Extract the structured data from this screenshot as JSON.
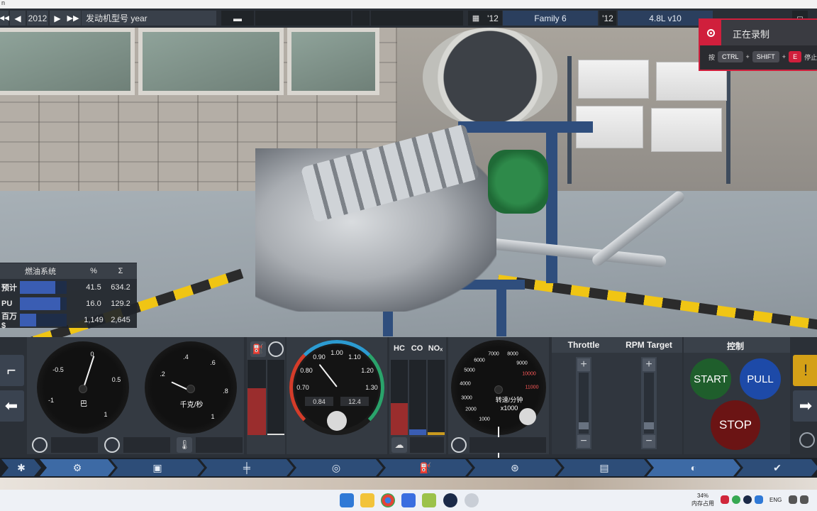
{
  "window": {
    "title_fragment": "n"
  },
  "topbar": {
    "year": "2012",
    "model_label": "发动机型号 year",
    "year_short_1": "'12",
    "family": "Family 6",
    "year_short_2": "'12",
    "variant": "4.8L v10"
  },
  "recording": {
    "title": "正在录制",
    "hint_prefix": "按",
    "key_ctrl": "CTRL",
    "plus1": "+",
    "key_shift": "SHIFT",
    "plus2": "+",
    "key_e": "E",
    "hint_suffix": "停止并"
  },
  "fuel_table": {
    "title": "燃油系统",
    "col_pct": "%",
    "col_sum": "Σ",
    "rows": [
      {
        "label": "预计",
        "fill": 0.76,
        "pct": "41.5",
        "sum": "634.2"
      },
      {
        "label": "PU",
        "fill": 0.86,
        "pct": "16.0",
        "sum": "129.2"
      },
      {
        "label": "百万$",
        "fill": 0.35,
        "pct": "1,149",
        "sum": "2,645"
      }
    ]
  },
  "gauges": {
    "g1": {
      "ticks": [
        "-0.5",
        "0",
        "0.5",
        "-1",
        "1"
      ],
      "unit": "巴"
    },
    "g2": {
      "ticks": [
        ".4",
        ".6",
        ".2",
        ".8",
        "1"
      ],
      "unit": "千克/秒"
    },
    "g3": {
      "ticks": [
        "0.90",
        "1.00",
        "1.10",
        "0.80",
        "1.20",
        "0.70",
        "1.30"
      ],
      "left_value": "0.84",
      "right_value": "12.4"
    },
    "rpm": {
      "ticks": [
        "7000",
        "8000",
        "6000",
        "9000",
        "5000",
        "10000",
        "4000",
        "11000",
        "3000",
        "2000",
        "1000"
      ],
      "unit_line1": "转速/分钟",
      "unit_line2": "x1000"
    }
  },
  "emissions": {
    "hc": "HC",
    "co": "CO",
    "nox": "NOₓ",
    "hc_level": 0.42,
    "co_level": 0.08,
    "nox_level": 0.04
  },
  "fuel_level": 0.62,
  "controls": {
    "throttle_label": "Throttle",
    "rpm_target_label": "RPM Target",
    "control_label": "控制",
    "start": "START",
    "pull": "PULL",
    "stop": "STOP",
    "plus": "+",
    "minus": "−"
  },
  "taskbar": {
    "cpu_pct": "34%",
    "mem_label": "内存占用",
    "lang": "ENG"
  },
  "colors": {
    "accent_blue": "#2d4d78",
    "record_red": "#d01f3c",
    "start_green": "#1f5e2c",
    "pull_blue": "#1d4aa8",
    "stop_red": "#6b1414"
  }
}
